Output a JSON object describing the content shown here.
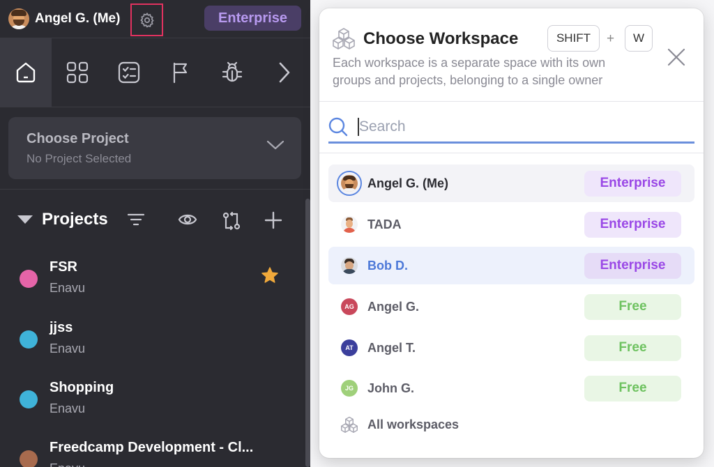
{
  "header": {
    "user_name": "Angel G. (Me)",
    "plan_badge": "Enterprise"
  },
  "nav": {
    "items": [
      {
        "icon": "home-icon",
        "active": true
      },
      {
        "icon": "grid-icon",
        "active": false
      },
      {
        "icon": "checklist-icon",
        "active": false
      },
      {
        "icon": "flag-icon",
        "active": false
      },
      {
        "icon": "bug-icon",
        "active": false
      },
      {
        "icon": "chevron-right-icon",
        "active": false
      }
    ]
  },
  "project_chooser": {
    "title": "Choose Project",
    "subtitle": "No Project Selected"
  },
  "projects": {
    "heading": "Projects",
    "items": [
      {
        "name": "FSR",
        "owner": "Enavu",
        "color": "#e564a8",
        "starred": true
      },
      {
        "name": "jjss",
        "owner": "Enavu",
        "color": "#3fb3d9",
        "starred": false
      },
      {
        "name": "Shopping",
        "owner": "Enavu",
        "color": "#3fb3d9",
        "starred": false
      },
      {
        "name": "Freedcamp Development - Cl...",
        "owner": "Enavu",
        "color": "#a86b4e",
        "starred": false
      }
    ]
  },
  "popup": {
    "title": "Choose Workspace",
    "shortcut_key1": "SHIFT",
    "shortcut_plus": "+",
    "shortcut_key2": "W",
    "description": "Each workspace is a separate space with its own groups and projects, belonging to a single owner",
    "search_placeholder": "Search",
    "workspaces": [
      {
        "name": "Angel G. (Me)",
        "plan": "Enterprise",
        "avatar": "photo-angel"
      },
      {
        "name": "TADA",
        "plan": "Enterprise",
        "avatar": "photo-tada"
      },
      {
        "name": "Bob D.",
        "plan": "Enterprise",
        "avatar": "photo-bob"
      },
      {
        "name": "Angel G.",
        "plan": "Free",
        "initials": "AG",
        "avatar_color": "#c9485b"
      },
      {
        "name": "Angel T.",
        "plan": "Free",
        "initials": "AT",
        "avatar_color": "#3b3f9c"
      },
      {
        "name": "John G.",
        "plan": "Free",
        "initials": "JG",
        "avatar_color": "#9fd07a"
      }
    ],
    "all_workspaces_label": "All workspaces"
  },
  "colors": {
    "sidebar_bg": "#2b2b31",
    "enterprise_text": "#9a48e6",
    "free_text": "#6ec260",
    "accent_blue": "#4c78d8",
    "highlight_border": "#e0325f",
    "star": "#f0a93b"
  }
}
